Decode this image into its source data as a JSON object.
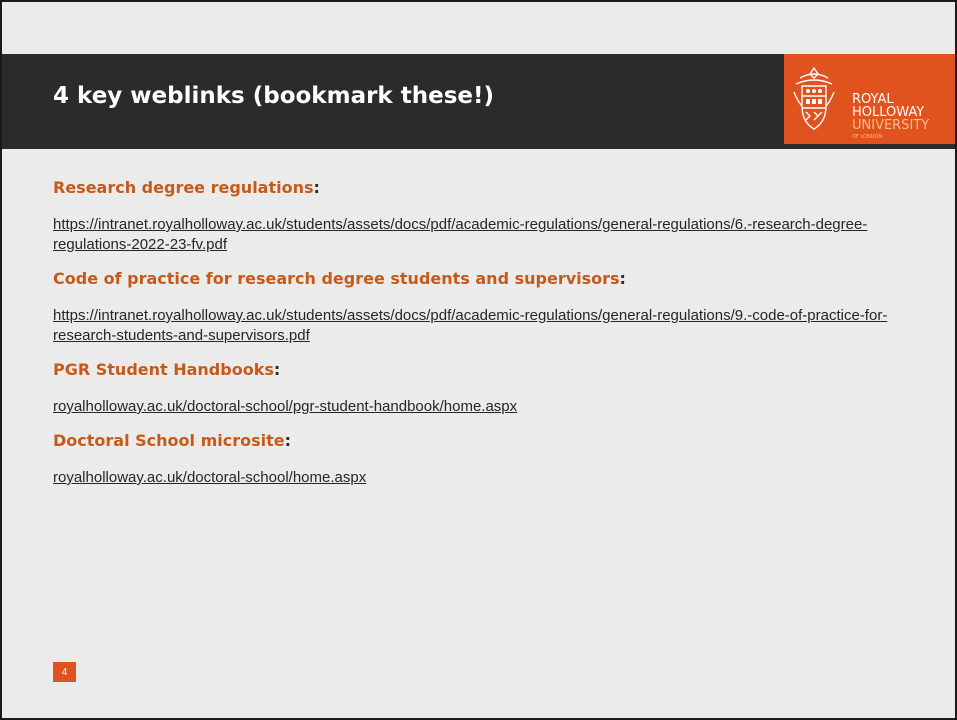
{
  "slide": {
    "title": "4 key weblinks (bookmark these!)",
    "page_number": "4"
  },
  "logo": {
    "line1": "ROYAL",
    "line2": "HOLLOWAY",
    "line3": "UNIVERSITY",
    "line4": "OF LONDON",
    "crest_icon": "university-crest-icon"
  },
  "colors": {
    "accent_orange": "#e0521e",
    "heading_orange": "#c55a1a",
    "header_dark": "#2b2b2b",
    "background": "#ebebeb"
  },
  "sections": [
    {
      "heading": "Research degree regulations",
      "links": [
        "https://intranet.royalholloway.ac.uk/students/assets/docs/pdf/academic-regulations/general-regulations/6.-research-degree-regulations-2022-23-fv.pdf"
      ]
    },
    {
      "heading": "Code of practice for research degree students and supervisors",
      "links": [
        "https://intranet.royalholloway.ac.uk/students/assets/docs/pdf/academic-regulations/general-regulations/9.-code-of-practice-for-research-students-and-supervisors.pdf"
      ]
    },
    {
      "heading": "PGR Student Handbooks",
      "links": [
        "royalholloway.ac.uk/doctoral-school/pgr-student-handbook/home.aspx"
      ]
    },
    {
      "heading": "Doctoral School microsite",
      "links": [
        "royalholloway.ac.uk/doctoral-school/home.aspx"
      ]
    }
  ]
}
